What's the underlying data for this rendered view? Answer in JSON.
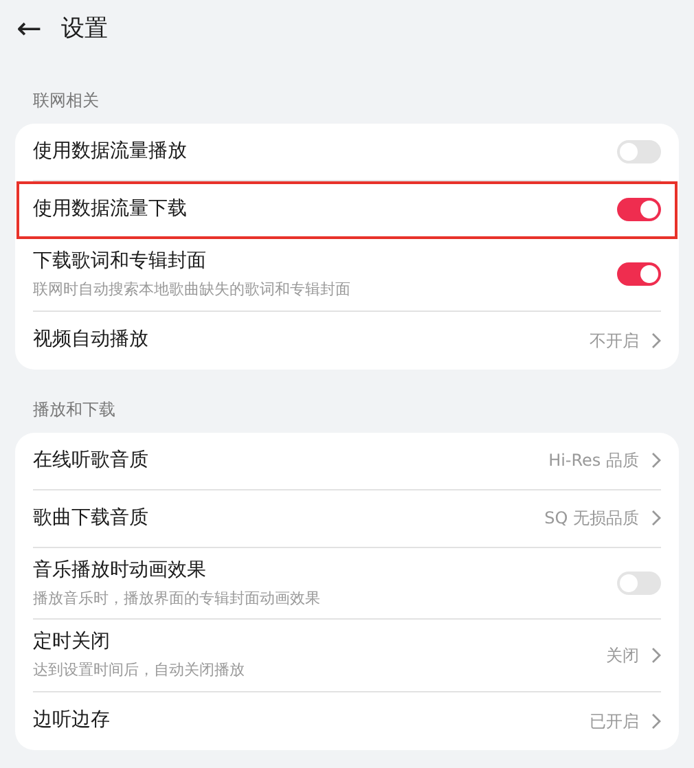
{
  "header": {
    "back": "←",
    "title": "设置"
  },
  "sections": [
    {
      "title": "联网相关",
      "items": [
        {
          "kind": "toggle",
          "label": "使用数据流量播放",
          "on": false,
          "highlighted": false
        },
        {
          "kind": "toggle",
          "label": "使用数据流量下载",
          "on": true,
          "highlighted": true
        },
        {
          "kind": "toggle",
          "label": "下载歌词和专辑封面",
          "description": "联网时自动搜索本地歌曲缺失的歌词和专辑封面",
          "on": true,
          "highlighted": false
        },
        {
          "kind": "link",
          "label": "视频自动播放",
          "value": "不开启",
          "highlighted": false
        }
      ]
    },
    {
      "title": "播放和下载",
      "items": [
        {
          "kind": "link",
          "label": "在线听歌音质",
          "value": "Hi-Res 品质",
          "highlighted": false
        },
        {
          "kind": "link",
          "label": "歌曲下载音质",
          "value": "SQ 无损品质",
          "highlighted": false
        },
        {
          "kind": "toggle",
          "label": "音乐播放时动画效果",
          "description": "播放音乐时，播放界面的专辑封面动画效果",
          "on": false,
          "highlighted": false
        },
        {
          "kind": "link",
          "label": "定时关闭",
          "description": "达到设置时间后，自动关闭播放",
          "value": "关闭",
          "highlighted": false
        },
        {
          "kind": "link",
          "label": "边听边存",
          "value": "已开启",
          "highlighted": false
        }
      ]
    }
  ]
}
